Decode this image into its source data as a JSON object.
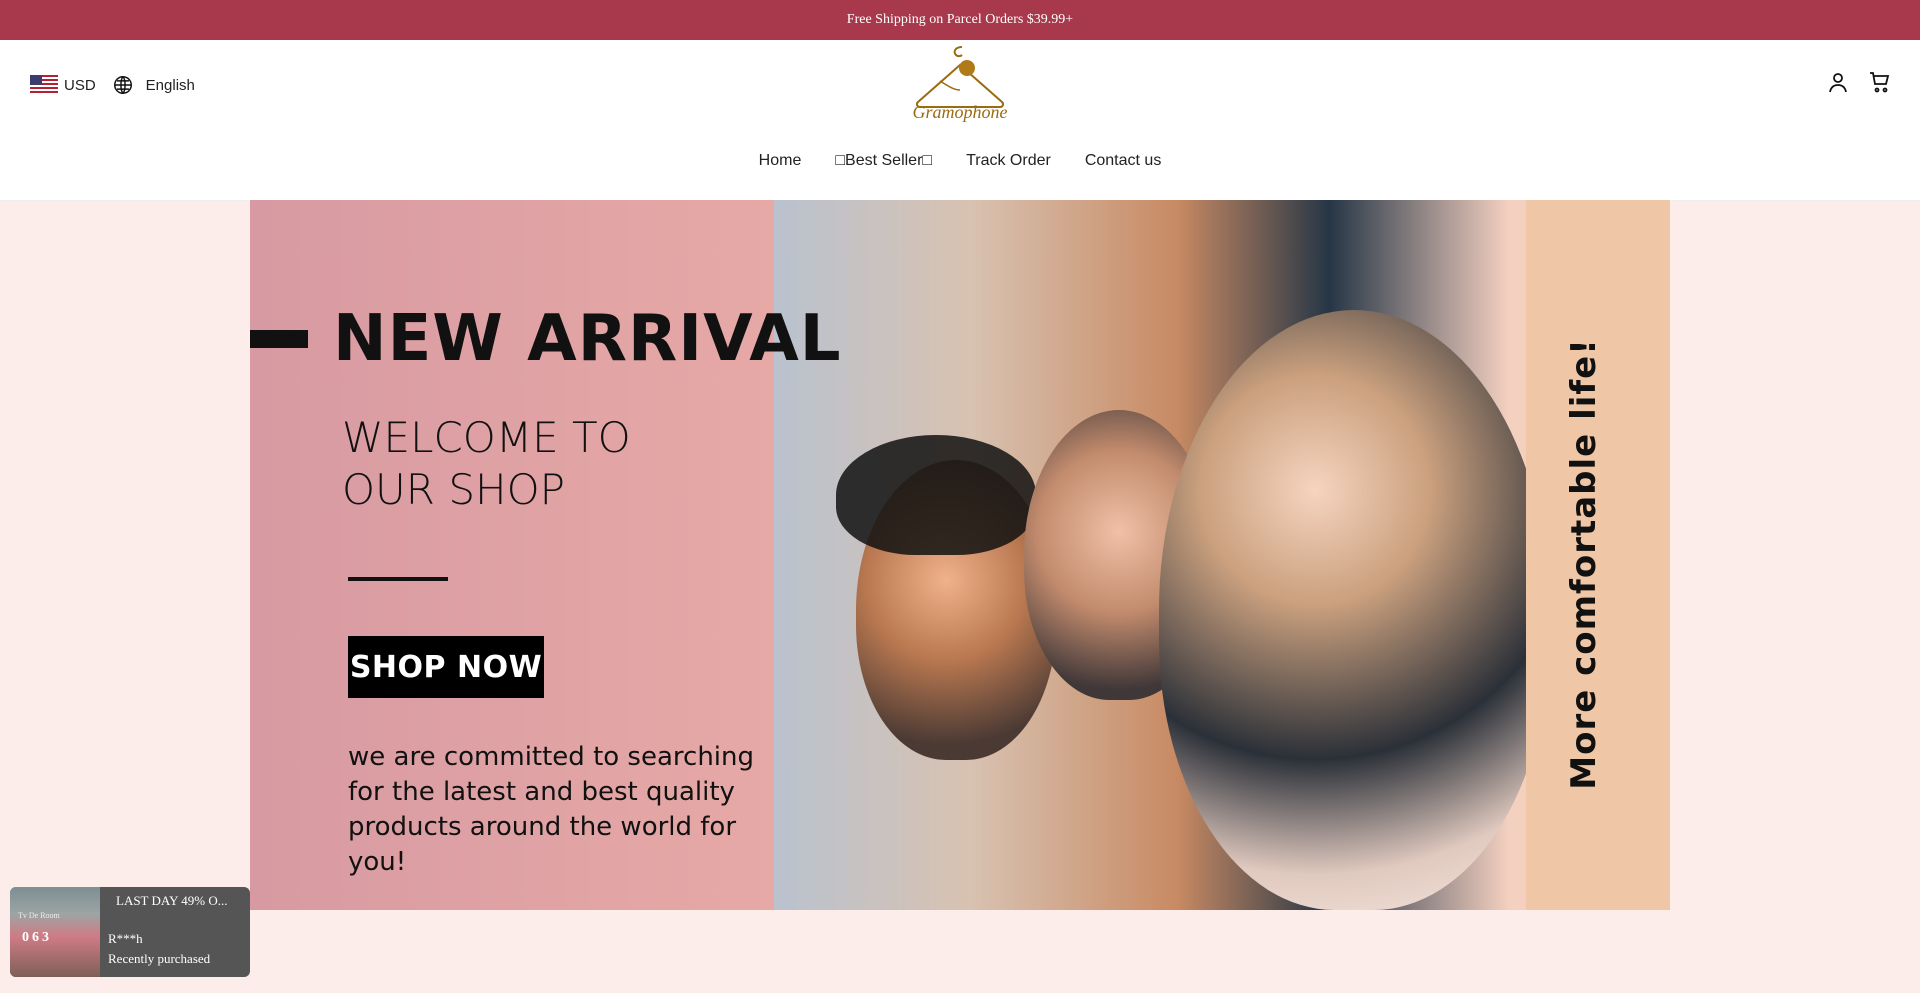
{
  "announcement": "Free Shipping on Parcel Orders $39.99+",
  "locale": {
    "currency": "USD",
    "language": "English"
  },
  "brand": {
    "logo_text": "Gramophone"
  },
  "nav": {
    "home": "Home",
    "best_seller": "Best Seller",
    "track_order": "Track Order",
    "contact": "Contact us"
  },
  "hero": {
    "headline": "NEW ARRIVAL",
    "welcome_1": "WELCOME TO",
    "welcome_2": "OUR SHOP",
    "cta": "SHOP NOW",
    "description": "we are committed to searching for the latest and best quality products around the world for you!",
    "side_text": "More comfortable life!"
  },
  "popup": {
    "title": "LAST DAY 49% O...",
    "user": "R***h",
    "status": "Recently purchased",
    "thumb_label": "Tv De Room",
    "thumb_numbers": "063"
  },
  "colors": {
    "topbar": "#a8384b",
    "page_bg": "#fcecea",
    "hero_left": "#d79aa2",
    "hero_side": "#efc7a6"
  }
}
